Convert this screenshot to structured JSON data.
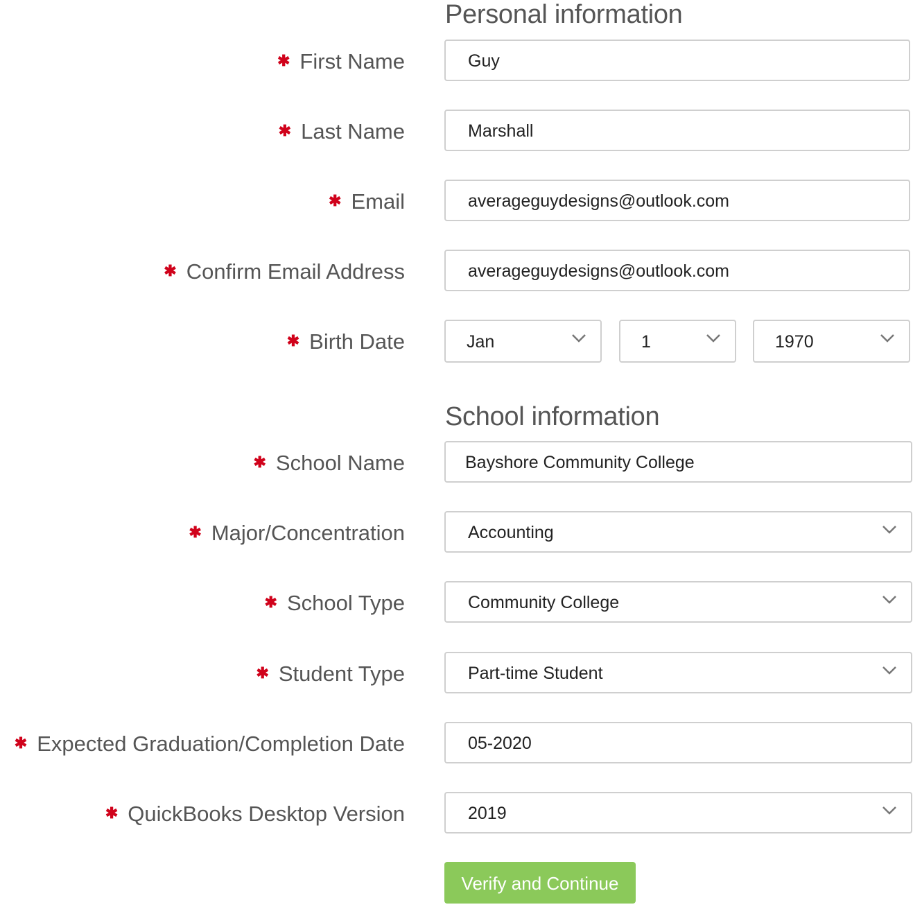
{
  "sections": {
    "personal_title": "Personal information",
    "school_title": "School information"
  },
  "required_marker": "✱",
  "fields": {
    "first_name": {
      "label": "First Name",
      "value": "Guy"
    },
    "last_name": {
      "label": "Last Name",
      "value": "Marshall"
    },
    "email": {
      "label": "Email",
      "value": "averageguydesigns@outlook.com"
    },
    "confirm_email": {
      "label": "Confirm Email Address",
      "value": "averageguydesigns@outlook.com"
    },
    "birth_date": {
      "label": "Birth Date",
      "month": "Jan",
      "day": "1",
      "year": "1970"
    },
    "school_name": {
      "label": "School Name",
      "value": "Bayshore Community College"
    },
    "major": {
      "label": "Major/Concentration",
      "value": "Accounting"
    },
    "school_type": {
      "label": "School Type",
      "value": "Community College"
    },
    "student_type": {
      "label": "Student Type",
      "value": "Part-time Student"
    },
    "graduation_date": {
      "label": "Expected Graduation/Completion Date",
      "value": "05-2020"
    },
    "qb_version": {
      "label": "QuickBooks Desktop Version",
      "value": "2019"
    }
  },
  "submit_label": "Verify and Continue",
  "colors": {
    "required": "#d0021b",
    "button": "#8bc95a"
  }
}
